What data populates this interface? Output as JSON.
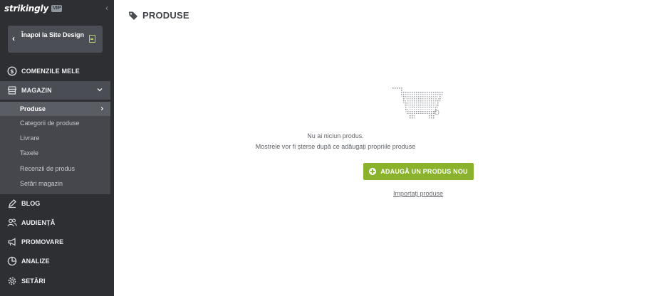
{
  "sidebar": {
    "logo": "strikingly",
    "badge": "VIP",
    "collapse_glyph": "‹",
    "back_button": {
      "label": "Înapoi la Site Design",
      "icon": "document-icon",
      "chevron": "‹"
    },
    "nav": {
      "orders": {
        "label": "COMENZILE MELE",
        "icon": "dollar-circle-icon"
      },
      "store": {
        "label": "MAGAZIN",
        "icon": "store-icon",
        "expanded": true
      },
      "blog": {
        "label": "BLOG",
        "icon": "pen-icon"
      },
      "audience": {
        "label": "AUDIENȚĂ",
        "icon": "people-icon"
      },
      "promote": {
        "label": "PROMOVARE",
        "icon": "megaphone-icon"
      },
      "analytics": {
        "label": "ANALIZE",
        "icon": "pie-chart-icon"
      },
      "settings": {
        "label": "SETĂRI",
        "icon": "gear-icon"
      }
    },
    "store_items": [
      {
        "label": "Produse",
        "active": true
      },
      {
        "label": "Categorii de produse"
      },
      {
        "label": "Livrare"
      },
      {
        "label": "Taxele"
      },
      {
        "label": "Recenzii de produs"
      },
      {
        "label": "Setări magazin"
      }
    ]
  },
  "main": {
    "title": "PRODUSE",
    "title_icon": "tag-icon",
    "empty_line1": "Nu ai niciun produs.",
    "empty_line2": "Mostrele vor fi șterse după ce adăugați propriile produse",
    "add_button": "ADAUGĂ UN PRODUS NOU",
    "import_link": "Importați produse"
  },
  "colors": {
    "sidebar_bg": "#2e2f33",
    "accent_green": "#8ab22d",
    "active_bg": "#5a5d63"
  }
}
